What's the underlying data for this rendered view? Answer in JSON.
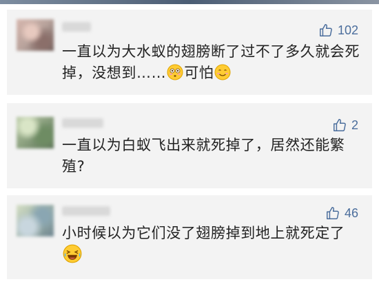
{
  "comments": [
    {
      "likes": "102",
      "text_before": "一直以为大水蚁的翅膀断了过不了多久就会死掉，没想到……",
      "emoji_1": "flushed-face-emoji",
      "text_middle": "可怕",
      "emoji_2": "smiling-face-emoji",
      "text_after": ""
    },
    {
      "likes": "2",
      "text_before": "一直以为白蚁飞出来就死掉了，居然还能繁殖?",
      "text_after": ""
    },
    {
      "likes": "46",
      "text_before": "小时候以为它们没了翅膀掉到地上就死定了",
      "emoji_1": "rolling-laughing-emoji"
    }
  ],
  "colors": {
    "card_bg": "#f3f3f3",
    "like_blue": "#4a6d9c",
    "text": "#222222"
  },
  "icons": {
    "like": "thumbs-up-outline-icon"
  }
}
